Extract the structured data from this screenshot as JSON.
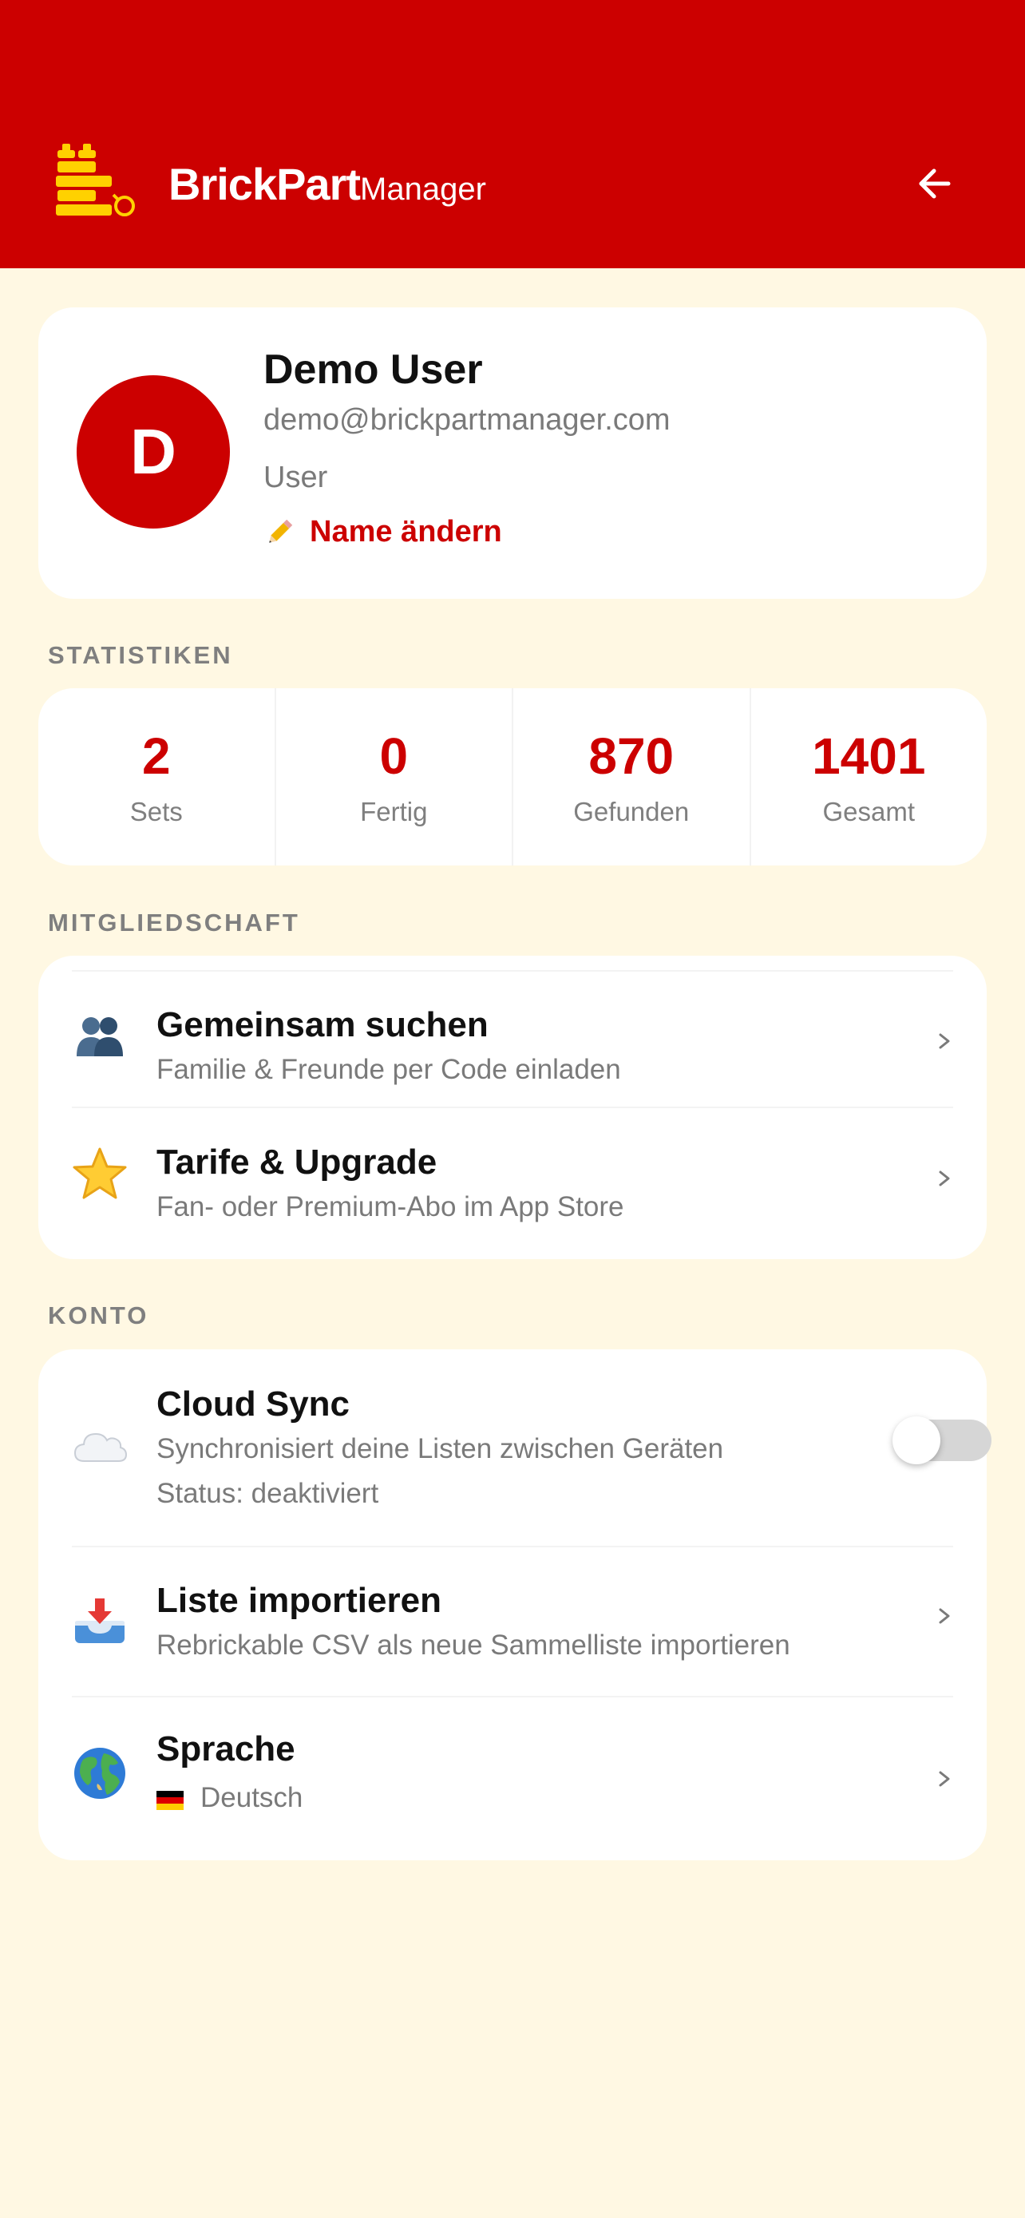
{
  "header": {
    "brand_bold": "BrickPart",
    "brand_light": "Manager",
    "colors": {
      "primary": "#CC0000",
      "logo": "#FFD100",
      "background": "#FFF8E3"
    },
    "icons": {
      "logo": "brick-search-logo-icon",
      "back": "arrow-left-icon"
    }
  },
  "profile": {
    "avatar_initial": "D",
    "name": "Demo User",
    "email": "demo@brickpartmanager.com",
    "role": "User",
    "edit_label": "Name ändern",
    "edit_icon": "pencil-icon"
  },
  "stats": {
    "section_label": "STATISTIKEN",
    "items": [
      {
        "value": "2",
        "label": "Sets"
      },
      {
        "value": "0",
        "label": "Fertig"
      },
      {
        "value": "870",
        "label": "Gefunden"
      },
      {
        "value": "1401",
        "label": "Gesamt"
      }
    ]
  },
  "membership": {
    "section_label": "MITGLIEDSCHAFT",
    "items": [
      {
        "title": "Gemeinsam suchen",
        "subtitle": "Familie & Freunde per Code einladen",
        "icon": "people-icon"
      },
      {
        "title": "Tarife & Upgrade",
        "subtitle": "Fan- oder Premium-Abo im App Store",
        "icon": "star-icon"
      }
    ]
  },
  "account": {
    "section_label": "KONTO",
    "cloud": {
      "title": "Cloud Sync",
      "subtitle": "Synchronisiert deine Listen zwischen Geräten",
      "status": "Status: deaktiviert",
      "enabled": false,
      "icon": "cloud-icon"
    },
    "import": {
      "title": "Liste importieren",
      "subtitle": "Rebrickable CSV als neue Sammelliste importieren",
      "icon": "inbox-tray-icon"
    },
    "language": {
      "title": "Sprache",
      "value": "Deutsch",
      "icon": "globe-icon",
      "flag_icon": "german-flag-icon"
    }
  }
}
